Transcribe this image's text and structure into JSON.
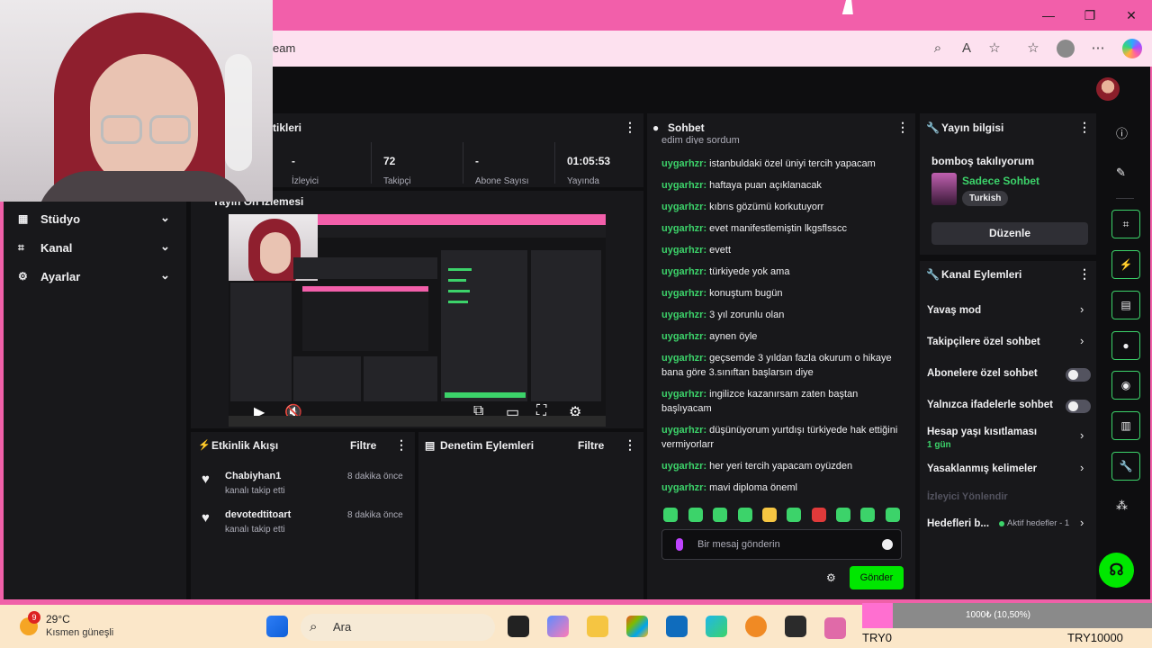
{
  "browser": {
    "url": "eam",
    "minimize": "—",
    "restore": "❐",
    "close": "✕"
  },
  "sidebar": {
    "items": [
      {
        "label": "Stüdyo",
        "icon": "studio-icon"
      },
      {
        "label": "Kanal",
        "icon": "channel-icon"
      },
      {
        "label": "Ayarlar",
        "icon": "settings-icon"
      }
    ]
  },
  "stats": {
    "title": "tikleri",
    "items": [
      {
        "value": "-",
        "label": "İzleyici"
      },
      {
        "value": "72",
        "label": "Takipçi"
      },
      {
        "value": "-",
        "label": "Abone Sayısı"
      },
      {
        "value": "01:05:53",
        "label": "Yayında"
      }
    ]
  },
  "preview": {
    "title": "Yayın Ön İzlemesi"
  },
  "activity": {
    "title": "Etkinlik Akışı",
    "filter": "Filtre",
    "items": [
      {
        "name": "Chabiyhan1",
        "sub": "kanalı takip etti",
        "time": "8 dakika önce"
      },
      {
        "name": "devotedtitoart",
        "sub": "kanalı takip etti",
        "time": "8 dakika önce"
      }
    ]
  },
  "moderation": {
    "title": "Denetim Eylemleri",
    "filter": "Filtre"
  },
  "chat": {
    "title": "Sohbet",
    "partial_top": "edim diye sordum",
    "messages": [
      {
        "user": "uygarhzr:",
        "text": " istanbuldaki özel üniyi tercih yapacam"
      },
      {
        "user": "uygarhzr:",
        "text": " haftaya puan açıklanacak"
      },
      {
        "user": "uygarhzr:",
        "text": " kıbrıs gözümü korkutuyorr"
      },
      {
        "user": "uygarhzr:",
        "text": " evet manifestlemiştin lkgsflsscc"
      },
      {
        "user": "uygarhzr:",
        "text": " evett"
      },
      {
        "user": "uygarhzr:",
        "text": " türkiyede yok ama"
      },
      {
        "user": "uygarhzr:",
        "text": " konuştum bugün"
      },
      {
        "user": "uygarhzr:",
        "text": " 3 yıl zorunlu olan"
      },
      {
        "user": "uygarhzr:",
        "text": " aynen öyle"
      },
      {
        "user": "uygarhzr:",
        "text": " geçsemde 3 yıldan fazla okurum o hikaye bana göre 3.sınıftan başlarsın diye"
      },
      {
        "user": "uygarhzr:",
        "text": " ingilizce kazanırsam zaten baştan başlıyacam"
      },
      {
        "user": "uygarhzr:",
        "text": " düşünüyorum yurtdışı türkiyede hak ettiğini vermiyorlarr"
      },
      {
        "user": "uygarhzr:",
        "text": " her yeri tercih yapacam oyüzden"
      },
      {
        "user": "uygarhzr:",
        "text": " mavi diploma öneml"
      }
    ],
    "placeholder": "Bir mesaj gönderin",
    "send_label": "Gönder"
  },
  "stream_info": {
    "title": "Yayın bilgisi",
    "stream_title": "bomboş takılıyorum",
    "category": "Sadece Sohbet",
    "tag": "Turkish",
    "edit_label": "Düzenle"
  },
  "channel_actions": {
    "title": "Kanal Eylemleri",
    "rows": [
      {
        "label": "Yavaş mod",
        "control": "chevron"
      },
      {
        "label": "Takipçilere özel sohbet",
        "control": "chevron"
      },
      {
        "label": "Abonelere özel sohbet",
        "control": "toggle"
      },
      {
        "label": "Yalnızca ifadelerle sohbet",
        "control": "toggle"
      },
      {
        "label": "Hesap yaşı kısıtlaması",
        "control": "chevron",
        "sub": "1 gün"
      },
      {
        "label": "Yasaklanmış kelimeler",
        "control": "chevron"
      }
    ],
    "muted_row": "İzleyici Yönlendir",
    "goals_label": "Hedefleri b...",
    "goals_tag": "Aktif hedefler - 1"
  },
  "taskbar": {
    "temp": "29°C",
    "weather": "Kısmen güneşli",
    "badge": "9",
    "search": "Ara",
    "donation_text": "1000₺ (10,50%)",
    "donation_progress": 0.105,
    "try_left": "TRY0",
    "try_right": "TRY10000"
  },
  "colors": {
    "accent_green": "#3cd36a",
    "browser_pink": "#f25faa",
    "panel_bg": "#18181b"
  }
}
